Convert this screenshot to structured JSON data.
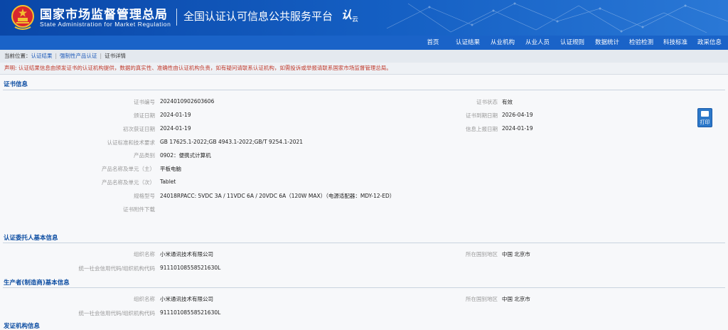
{
  "header": {
    "agency_cn": "国家市场监督管理总局",
    "agency_en": "State Administration  for  Market Regulation",
    "platform": "全国认证认可信息公共服务平台",
    "logo_mark": "认",
    "logo_small": "云",
    "colors": {
      "header_blue": "#0a47a8",
      "nav_blue": "#1a63c8",
      "section_blue": "#0c4da2",
      "notice_red": "#c0392b"
    }
  },
  "nav": {
    "items": [
      "首页",
      "认证结果",
      "从业机构",
      "从业人员",
      "认证规则",
      "数据统计",
      "检验检测",
      "科技标准",
      "政采信息"
    ]
  },
  "breadcrumb": {
    "prefix": "当前位置：",
    "items": [
      "认证结果",
      "强制性产品认证",
      "证书详情"
    ]
  },
  "notice": "声明: 认证结果信息由颁发证书的认证机构提供，数据的真实性、准确性由认证机构负责，如有疑问请联系认证机构，如需投诉或举报请联系国家市场监督管理总局。",
  "certificate": {
    "title": "证书信息",
    "fields": {
      "cert_no_label": "证书编号",
      "cert_no": "2024010902603606",
      "status_label": "证书状态",
      "status": "有效",
      "issue_date_label": "颁证日期",
      "issue_date": "2024-01-19",
      "expire_label": "证书到期日期",
      "expire": "2026-04-19",
      "first_issue_label": "初次获证日期",
      "first_issue": "2024-01-19",
      "upload_label": "信息上报日期",
      "upload": "2024-01-19",
      "standard_label": "认证标准和技术要求",
      "standard": "GB 17625.1-2022;GB 4943.1-2022;GB/T 9254.1-2021",
      "category_label": "产品类别",
      "category": "0902：便携式计算机",
      "name_main_label": "产品名称及单元（主）",
      "name_main": "平板电脑",
      "name_sub_label": "产品名称及单元（次）",
      "name_sub": "Tablet",
      "model_label": "规格型号",
      "model": "24018RPACC: 5VDC 3A / 11VDC 6A / 20VDC 6A（120W MAX）（电源适配器：MDY-12-ED）",
      "attachment_label": "证书附件下载"
    }
  },
  "print_button": {
    "label": "打印",
    "icon": "printer-icon"
  },
  "client": {
    "title": "认证委托人基本信息",
    "org_label": "组织名称",
    "org": "小米通讯技术有限公司",
    "region_label": "所在国别地区",
    "region": "中国 北京市",
    "code_label": "统一社会信用代码/组织机构代码",
    "code": "91110108558521630L"
  },
  "producer": {
    "title": "生产者(制造商)基本信息",
    "org_label": "组织名称",
    "org": "小米通讯技术有限公司",
    "region_label": "所在国别地区",
    "region": "中国 北京市",
    "code_label": "统一社会信用代码/组织机构代码",
    "code": "91110108558521630L"
  },
  "issuer": {
    "title": "发证机构信息"
  }
}
